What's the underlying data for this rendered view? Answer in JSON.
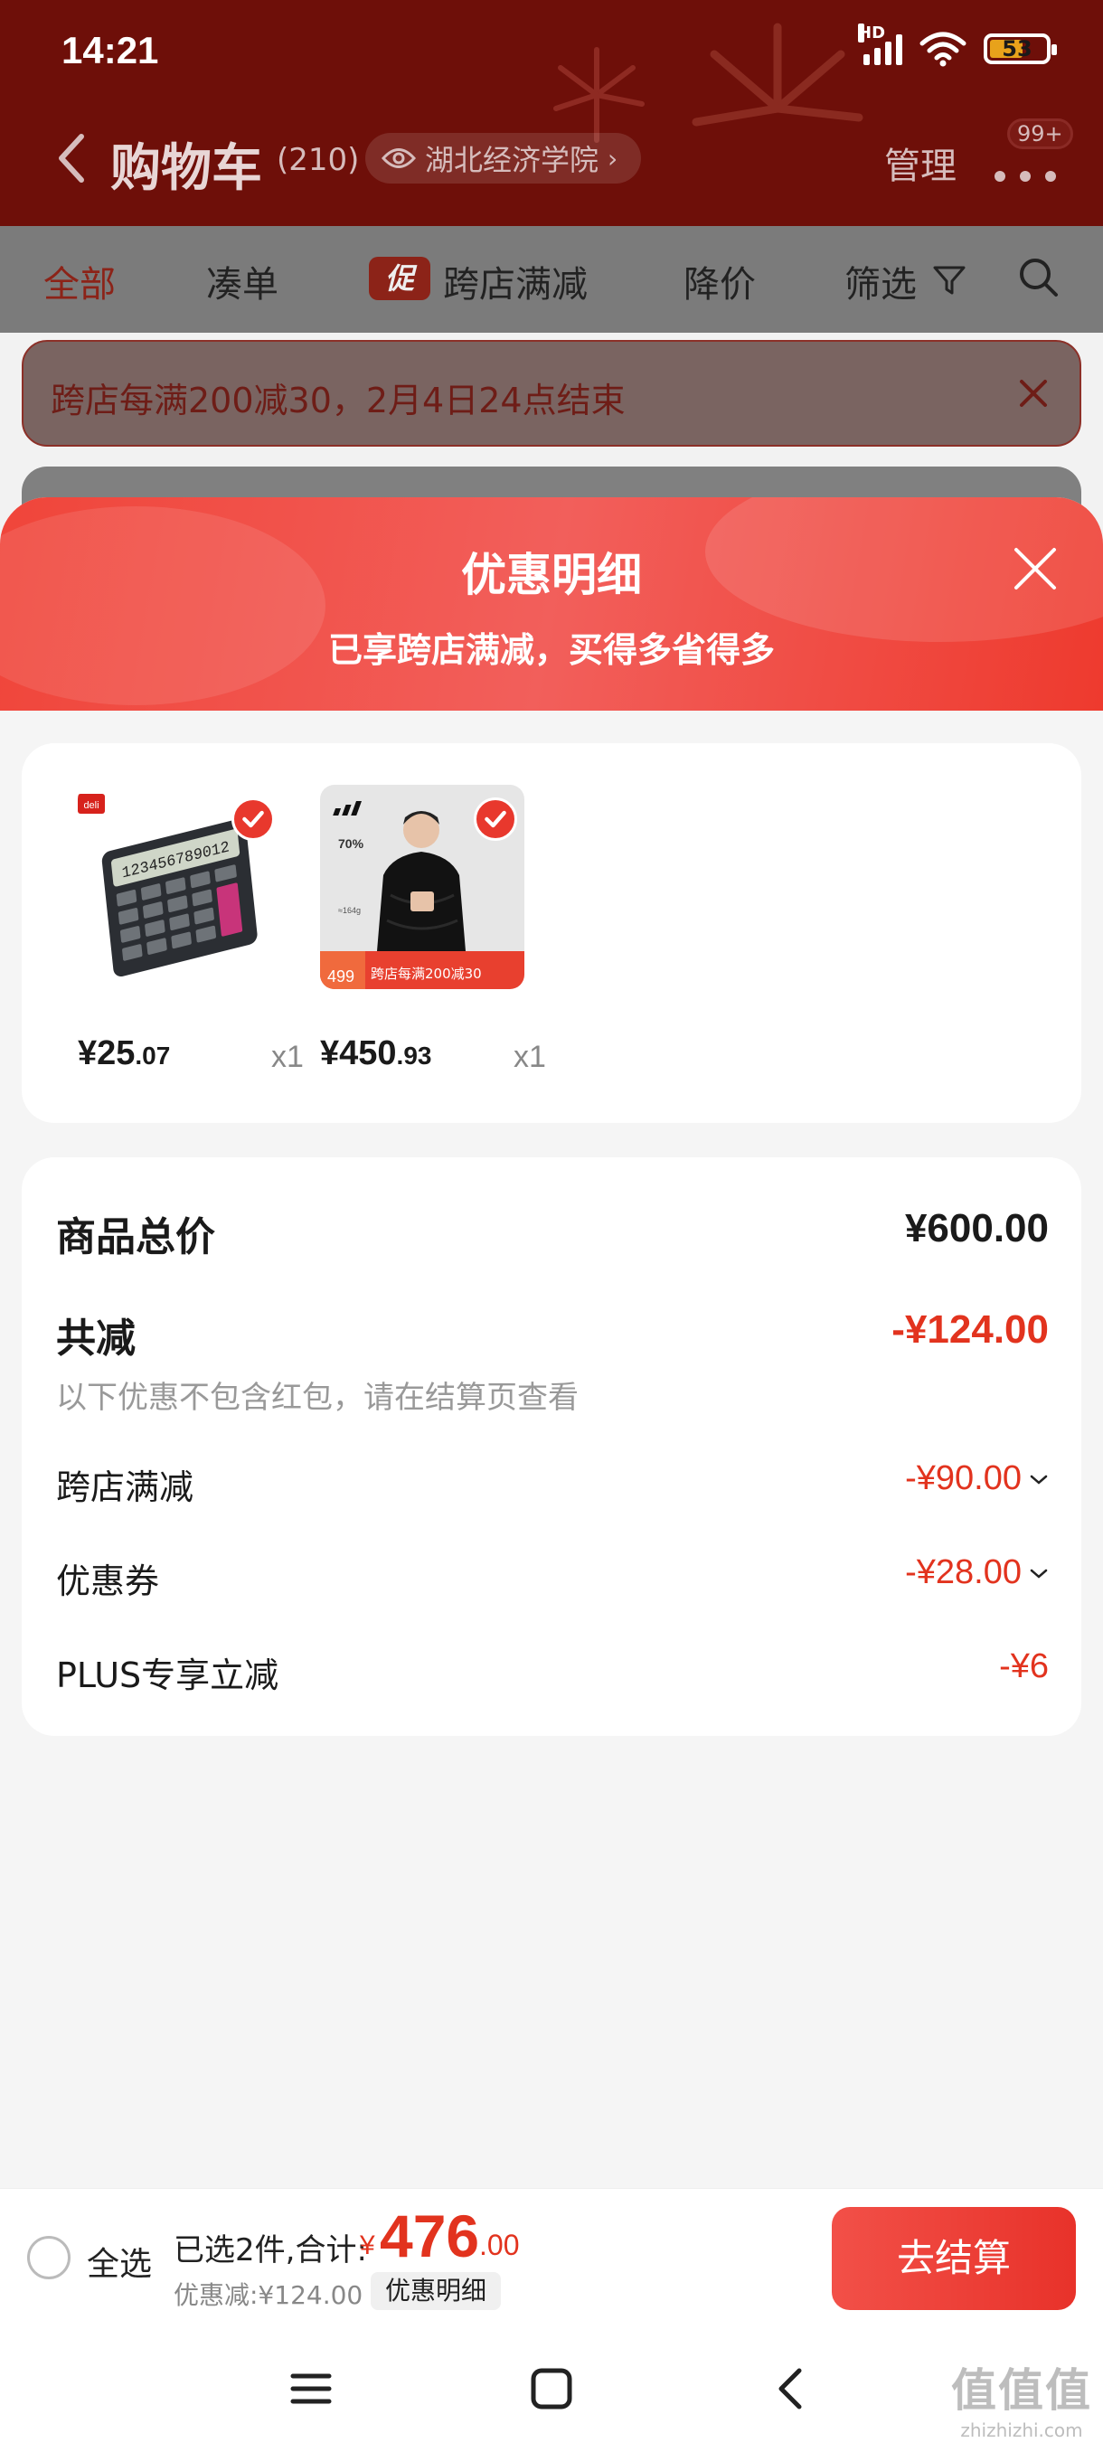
{
  "status_bar": {
    "time": "14:21",
    "network_label": "HD",
    "battery": "53"
  },
  "top_bar": {
    "title": "购物车",
    "count": "(210)",
    "location": "湖北经济学院",
    "manage": "管理",
    "messages_badge": "99+"
  },
  "filter_tabs": {
    "all": "全部",
    "bundle": "凑单",
    "promo_badge": "促",
    "cross_store": "跨店满减",
    "price_drop": "降价",
    "filter": "筛选"
  },
  "promo_banner": {
    "text": "跨店每满200减30，2月4日24点结束"
  },
  "sheet": {
    "title": "优惠明细",
    "subtitle": "已享跨店满减，买得多省得多"
  },
  "products": [
    {
      "name": "calculator",
      "price_int": "¥25",
      "price_dec": ".07",
      "qty": "x1",
      "brand": "deli"
    },
    {
      "name": "down-jacket",
      "price_int": "¥450",
      "price_dec": ".93",
      "qty": "x1",
      "promo": "跨店每满200减30",
      "tag_price": "499",
      "spec1": "70%",
      "spec2": "≈164g"
    }
  ],
  "summary": {
    "total_label": "商品总价",
    "total_value": "¥600.00",
    "discount_label": "共减",
    "discount_value": "-¥124.00",
    "note": "以下优惠不包含红包，请在结算页查看",
    "items": [
      {
        "label": "跨店满减",
        "value": "-¥90.00"
      },
      {
        "label": "优惠券",
        "value": "-¥28.00"
      },
      {
        "label": "PLUS专享立减",
        "value": "-¥6"
      }
    ]
  },
  "checkout": {
    "select_all": "全选",
    "selected_text": "已选2件,合计:",
    "currency": "¥",
    "total_int": "476",
    "total_dec": ".00",
    "saved_text": "优惠减:¥124.00",
    "detail_button": "优惠明细",
    "pay_button": "去结算"
  },
  "watermark": {
    "glyphs": "值值值",
    "url": "zhizhizhi.com"
  },
  "colors": {
    "accent": "#e8382d",
    "price_red": "#e2331e",
    "header_dark": "#6e0f09"
  }
}
